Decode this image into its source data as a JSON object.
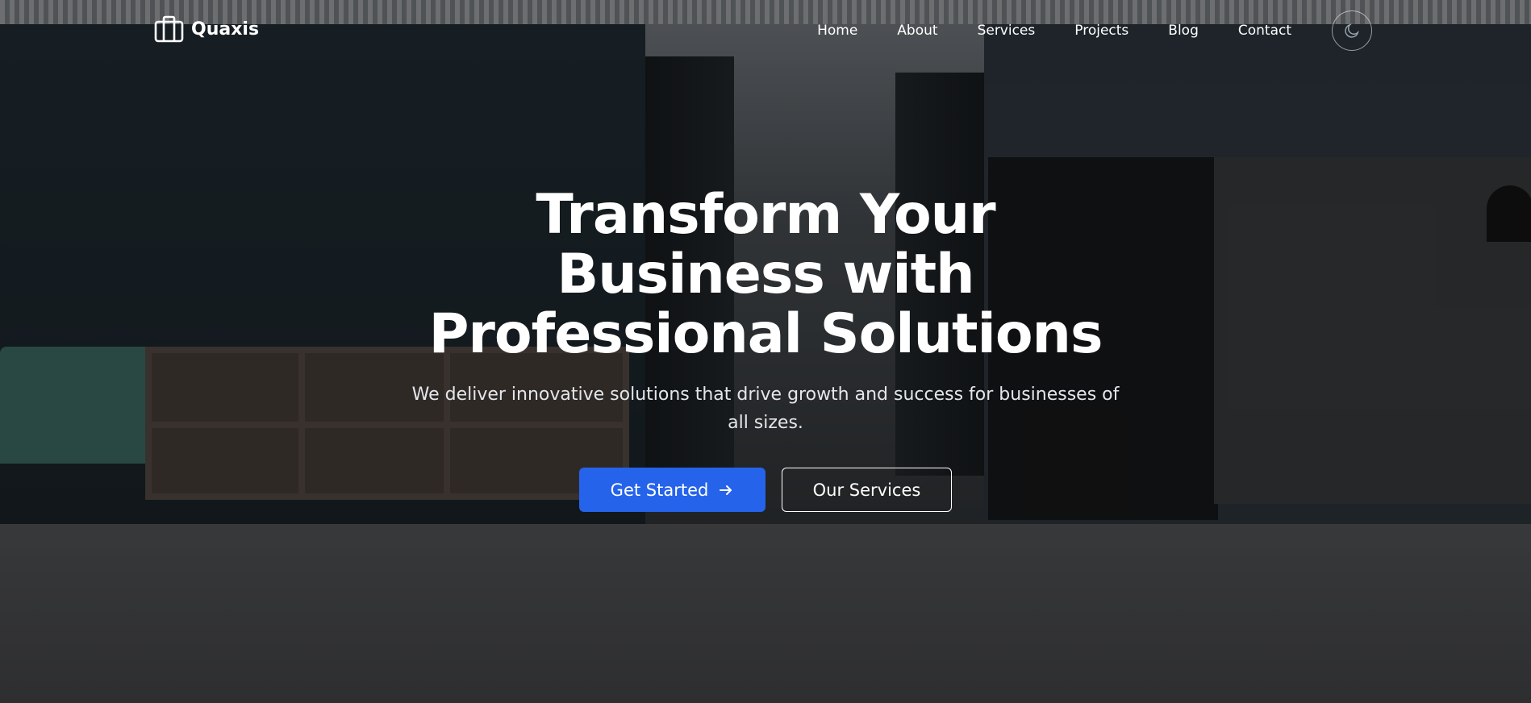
{
  "brand": {
    "name": "Quaxis",
    "icon": "briefcase-icon"
  },
  "nav": {
    "items": [
      {
        "label": "Home"
      },
      {
        "label": "About"
      },
      {
        "label": "Services"
      },
      {
        "label": "Projects"
      },
      {
        "label": "Blog"
      },
      {
        "label": "Contact"
      }
    ],
    "theme_toggle_icon": "moon-icon"
  },
  "hero": {
    "headline": "Transform Your Business with Professional Solutions",
    "subtitle": "We deliver innovative solutions that drive growth and success for businesses of all sizes.",
    "primary_cta": "Get Started",
    "primary_cta_icon": "arrow-right-icon",
    "secondary_cta": "Our Services"
  },
  "colors": {
    "accent": "#2563eb",
    "text": "#ffffff",
    "overlay": "rgba(0,0,0,0.48)"
  }
}
